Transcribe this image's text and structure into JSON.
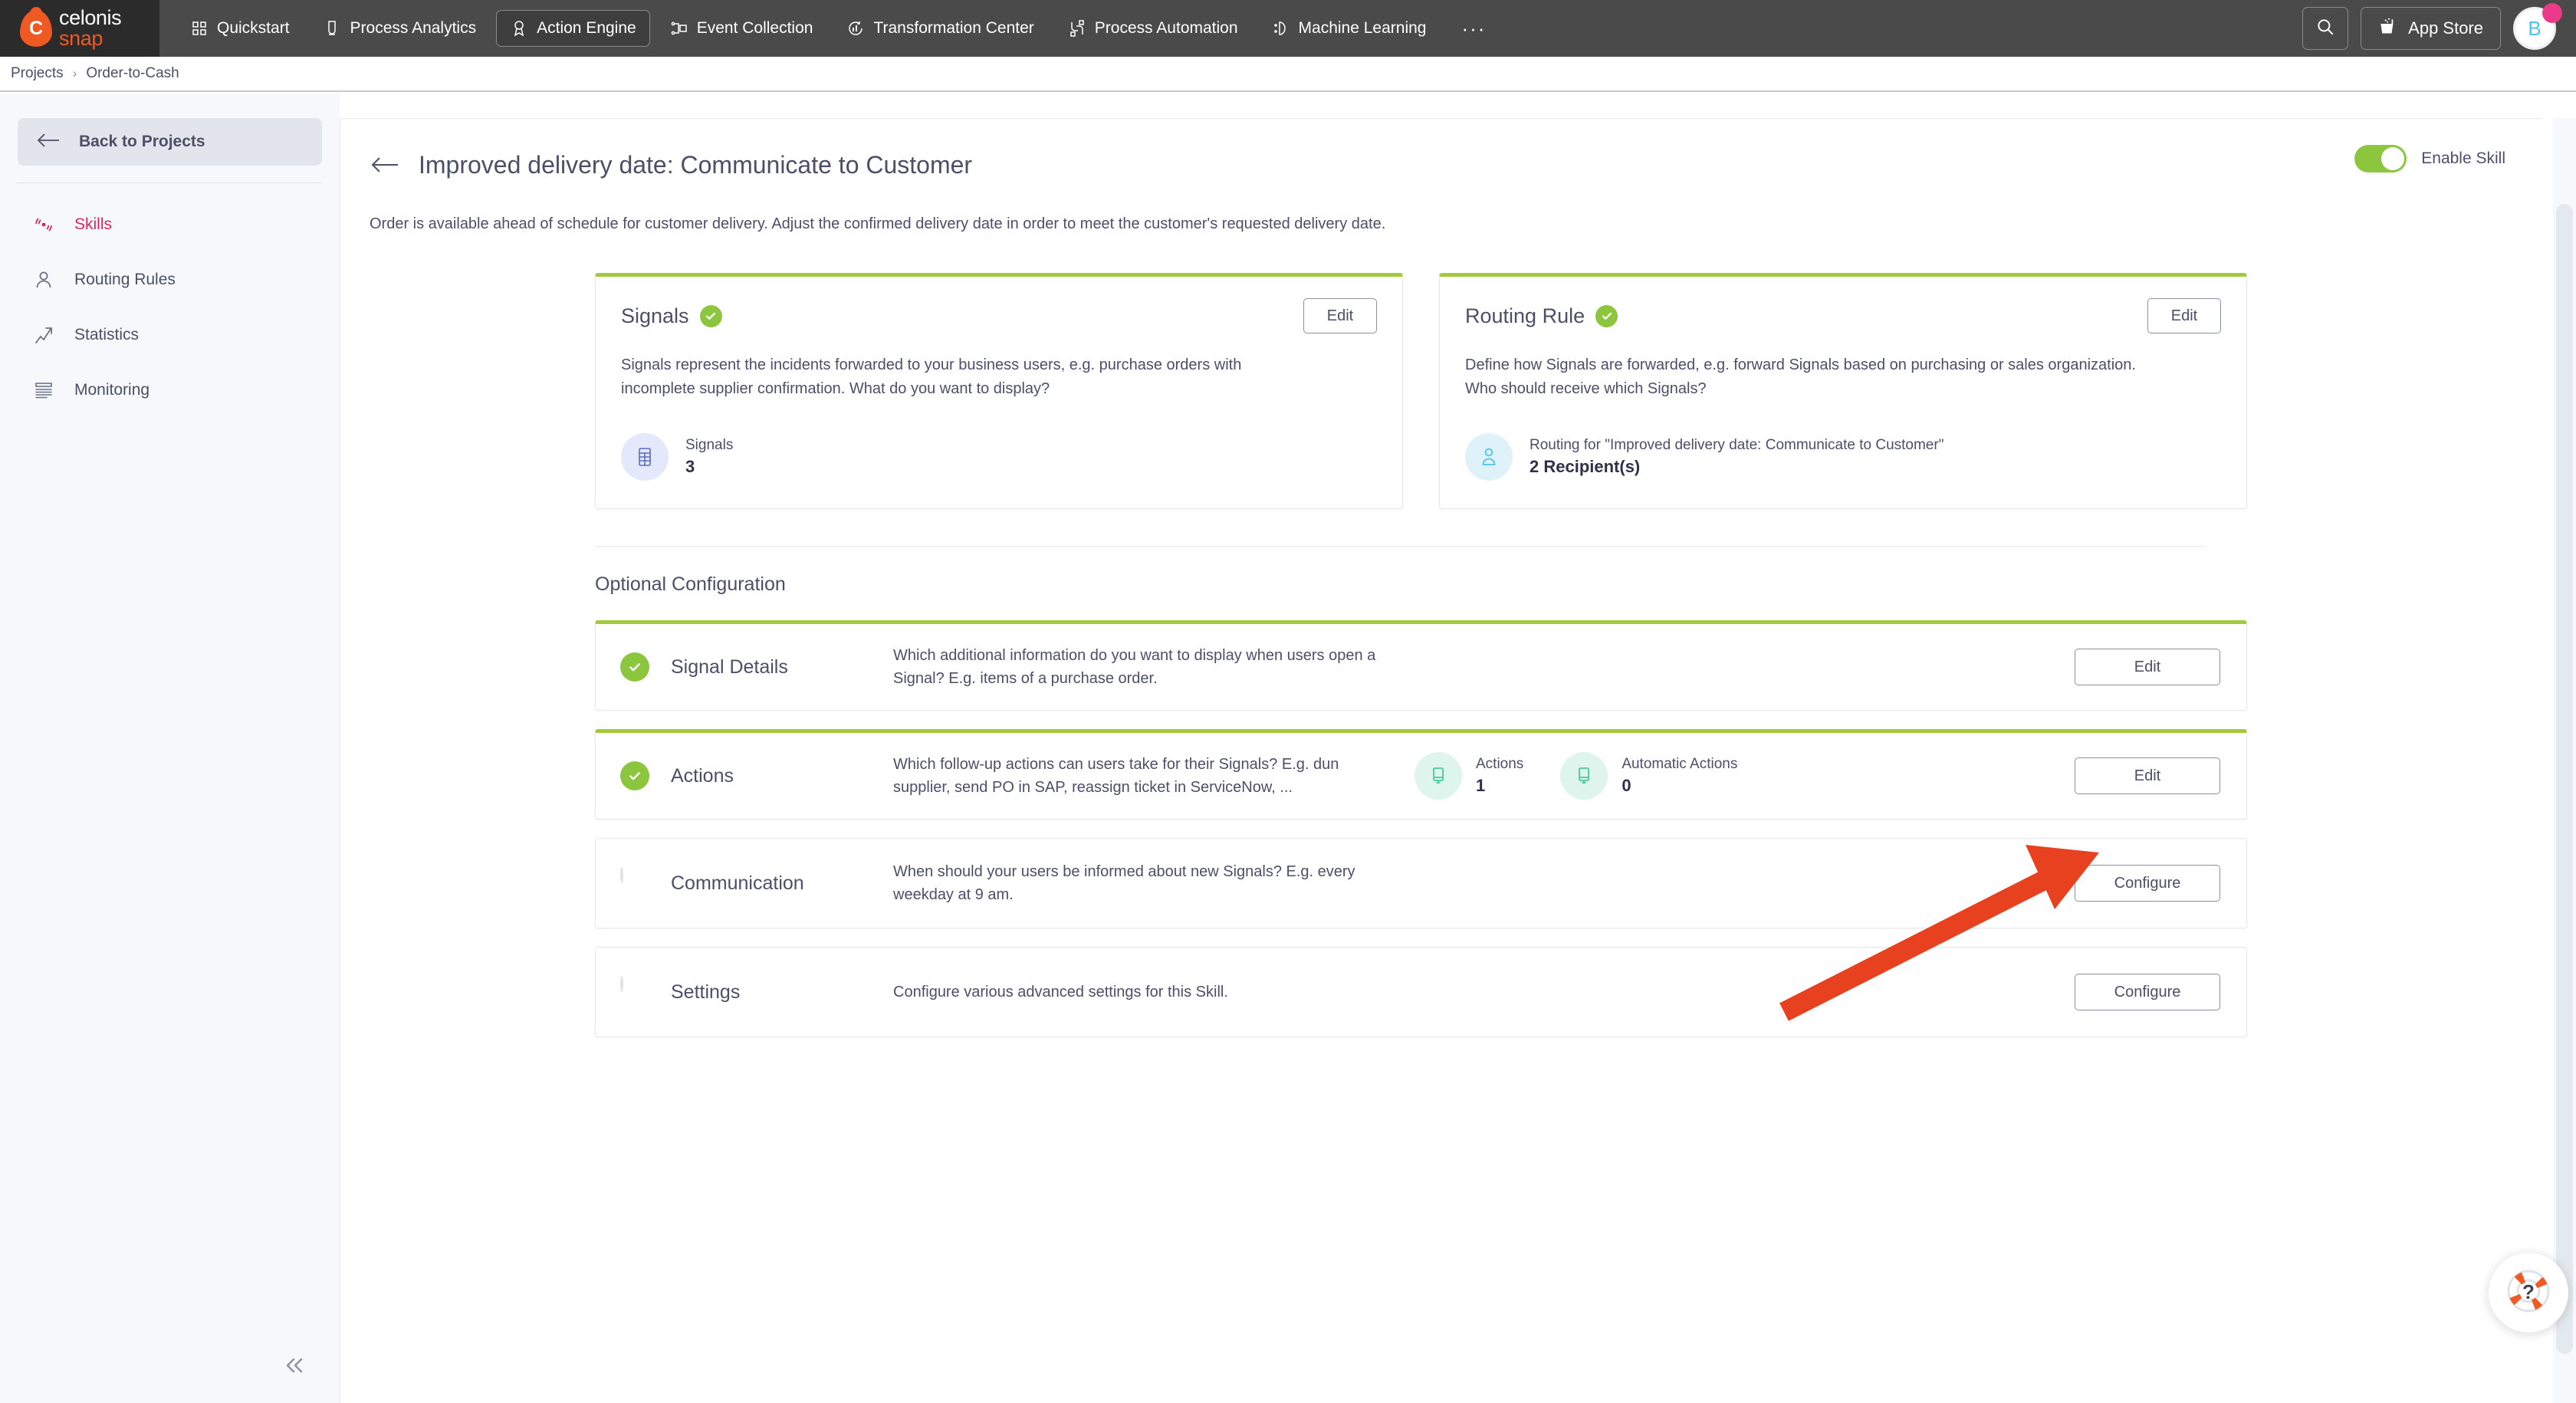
{
  "brand": {
    "line1": "celonis",
    "line2": "snap",
    "mark": "C"
  },
  "topnav": {
    "items": [
      {
        "label": "Quickstart",
        "icon": "quickstart-icon",
        "active": false
      },
      {
        "label": "Process Analytics",
        "icon": "process-analytics-icon",
        "active": false
      },
      {
        "label": "Action Engine",
        "icon": "action-engine-icon",
        "active": true
      },
      {
        "label": "Event Collection",
        "icon": "event-collection-icon",
        "active": false
      },
      {
        "label": "Transformation Center",
        "icon": "transformation-center-icon",
        "active": false
      },
      {
        "label": "Process Automation",
        "icon": "process-automation-icon",
        "active": false
      },
      {
        "label": "Machine Learning",
        "icon": "machine-learning-icon",
        "active": false
      }
    ],
    "overflow_label": "···",
    "search_icon": "search-icon",
    "app_store_label": "App Store",
    "app_store_icon": "app-store-icon",
    "avatar_initial": "B",
    "avatar_badge_color": "#ec3a8b"
  },
  "breadcrumb": {
    "root": "Projects",
    "separator": "›",
    "current": "Order-to-Cash"
  },
  "sidebar": {
    "back_label": "Back to Projects",
    "items": [
      {
        "label": "Skills",
        "icon": "signal-icon",
        "active": true
      },
      {
        "label": "Routing Rules",
        "icon": "user-icon",
        "active": false
      },
      {
        "label": "Statistics",
        "icon": "trend-arrow-icon",
        "active": false
      },
      {
        "label": "Monitoring",
        "icon": "list-lines-icon",
        "active": false
      }
    ],
    "collapse_icon": "double-chevron-left-icon"
  },
  "page": {
    "title": "Improved delivery date: Communicate to Customer",
    "description": "Order is available ahead of schedule for customer delivery. Adjust the confirmed delivery date in order to meet the customer's requested delivery date.",
    "toggle_label": "Enable Skill",
    "toggle_on": true,
    "toggle_color": "#8cc63f",
    "back_icon": "arrow-left-icon"
  },
  "cards": [
    {
      "title": "Signals",
      "status": "complete",
      "edit_label": "Edit",
      "description": "Signals represent the incidents forwarded to your business users, e.g. purchase orders with incomplete supplier confirmation. What do you want to display?",
      "metric_icon": "table-grid-icon",
      "metric_label": "Signals",
      "metric_value": "3"
    },
    {
      "title": "Routing Rule",
      "status": "complete",
      "edit_label": "Edit",
      "description": "Define how Signals are forwarded, e.g. forward Signals based on purchasing or sales organization. Who should receive which Signals?",
      "metric_icon": "person-icon",
      "metric_label": "Routing for \"Improved delivery date: Communicate to Customer\"",
      "metric_value": "2 Recipient(s)"
    }
  ],
  "optional_configuration": {
    "section_title": "Optional Configuration",
    "rows": [
      {
        "name": "Signal Details",
        "status": "complete",
        "description": "Which additional information do you want to display when users open a Signal? E.g. items of a purchase order.",
        "button_label": "Edit",
        "metrics": []
      },
      {
        "name": "Actions",
        "status": "complete",
        "description": "Which follow-up actions can users take for their Signals? E.g. dun supplier, send PO in SAP, reassign ticket in ServiceNow, ...",
        "button_label": "Edit",
        "metrics": [
          {
            "icon": "monitor-icon",
            "label": "Actions",
            "value": "1"
          },
          {
            "icon": "monitor-icon",
            "label": "Automatic Actions",
            "value": "0"
          }
        ]
      },
      {
        "name": "Communication",
        "status": "incomplete",
        "description": "When should your users be informed about new Signals? E.g. every weekday at 9 am.",
        "button_label": "Configure",
        "metrics": []
      },
      {
        "name": "Settings",
        "status": "incomplete",
        "description": "Configure various advanced settings for this Skill.",
        "button_label": "Configure",
        "metrics": []
      }
    ]
  },
  "annotation": {
    "type": "arrow",
    "color": "#e8411f",
    "points_to": "actions-edit-button"
  },
  "help": {
    "icon": "life-ring-help-icon"
  },
  "colors": {
    "accent_green": "#8cc63f",
    "card_top_bar": "#a2ca3a",
    "active_sidebar": "#e0245e",
    "text_primary": "#4c4f68",
    "nav_background": "#4a4a4a"
  }
}
